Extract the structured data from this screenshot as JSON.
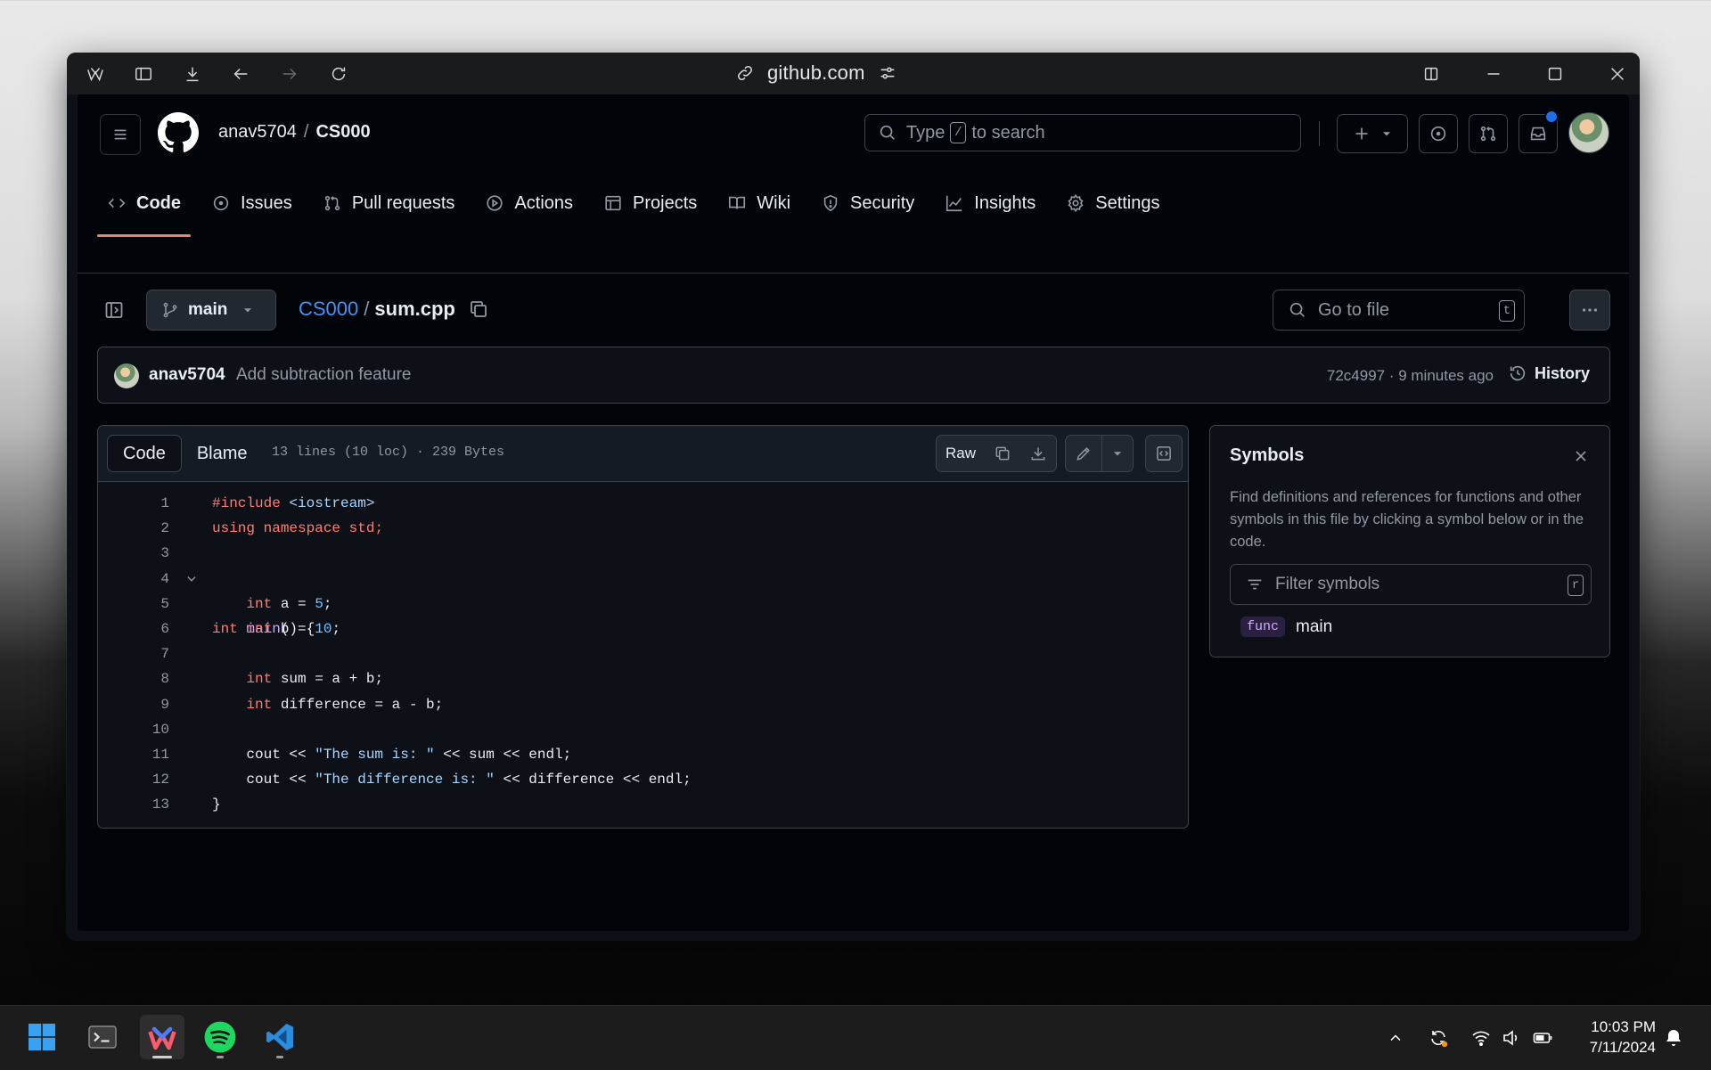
{
  "browser": {
    "url": "github.com"
  },
  "repo": {
    "owner": "anav5704",
    "separator": "/",
    "name": "CS000"
  },
  "search": {
    "pre": "Type",
    "key": "/",
    "post": "to search"
  },
  "tabs": [
    {
      "label": "Code",
      "icon": "code-icon",
      "active": true
    },
    {
      "label": "Issues",
      "icon": "issue-icon"
    },
    {
      "label": "Pull requests",
      "icon": "pull-request-icon"
    },
    {
      "label": "Actions",
      "icon": "play-icon"
    },
    {
      "label": "Projects",
      "icon": "table-icon"
    },
    {
      "label": "Wiki",
      "icon": "book-icon"
    },
    {
      "label": "Security",
      "icon": "shield-icon"
    },
    {
      "label": "Insights",
      "icon": "graph-icon"
    },
    {
      "label": "Settings",
      "icon": "gear-icon"
    }
  ],
  "file": {
    "branch": "main",
    "repo_link": "CS000",
    "separator": "/",
    "filename": "sum.cpp",
    "goto_placeholder": "Go to file",
    "goto_key": "t"
  },
  "commit": {
    "author": "anav5704",
    "message": "Add subtraction feature",
    "meta": "72c4997 · 9 minutes ago",
    "history_label": "History"
  },
  "code_view": {
    "tab_code": "Code",
    "tab_blame": "Blame",
    "info": "13 lines (10 loc) · 239 Bytes",
    "raw_label": "Raw",
    "lines": [
      "1",
      "2",
      "3",
      "4",
      "5",
      "6",
      "7",
      "8",
      "9",
      "10",
      "11",
      "12",
      "13"
    ]
  },
  "symbols": {
    "title": "Symbols",
    "description": "Find definitions and references for functions and other symbols in this file by clicking a symbol below or in the code.",
    "filter_placeholder": "Filter symbols",
    "filter_key": "r",
    "items": [
      {
        "kind": "func",
        "name": "main"
      }
    ]
  },
  "taskbar": {
    "time": "10:03 PM",
    "date": "7/11/2024"
  },
  "colors": {
    "accent_blue": "#4493f8",
    "tab_underline": "#f78166",
    "keyword": "#ff7b72",
    "function": "#d2a8ff",
    "string": "#a5d6ff",
    "number": "#79c0ff"
  }
}
